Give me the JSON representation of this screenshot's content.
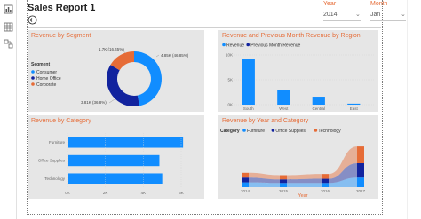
{
  "report": {
    "title": "Sales Report 1"
  },
  "slicers": {
    "year": {
      "label": "Year",
      "value": "2014"
    },
    "month": {
      "label": "Month",
      "value": "Jan"
    }
  },
  "colors": {
    "blue": "#118dff",
    "navy": "#12239e",
    "orange": "#e66c37",
    "accent_title": "#e66c37",
    "card_bg": "#e6e6e6"
  },
  "icons": [
    "bar-chart-icon",
    "table-icon",
    "model-icon",
    "back-arrow-icon",
    "chevron-down-icon"
  ],
  "charts": {
    "segment": {
      "title": "Revenue by Segment",
      "legend_title": "Segment",
      "chart_data": {
        "type": "pie",
        "donut": true,
        "categories": [
          "Consumer",
          "Home Office",
          "Corporate"
        ],
        "values": [
          4.85,
          3.81,
          1.7
        ],
        "data_labels": [
          "4.85K (46.85%)",
          "3.81K (36.8%)",
          "1.7K (16.45%)"
        ],
        "legend": "left"
      }
    },
    "region": {
      "title": "Revenue and Previous Month Revenue by Region",
      "legend": [
        "Revenue",
        "Previous Month Revenue"
      ],
      "chart_data": {
        "type": "bar",
        "categories": [
          "South",
          "West",
          "Central",
          "East"
        ],
        "series": [
          {
            "name": "Revenue",
            "values": [
              9200,
              3000,
              1600,
              200
            ]
          },
          {
            "name": "Previous Month Revenue",
            "values": [
              0,
              0,
              0,
              0
            ]
          }
        ],
        "y_ticks": [
          "0K",
          "5K",
          "10K"
        ],
        "ylim": [
          0,
          10000
        ]
      }
    },
    "category": {
      "title": "Revenue by Category",
      "chart_data": {
        "type": "bar",
        "orientation": "horizontal",
        "categories": [
          "Furniture",
          "Office Supplies",
          "Technology"
        ],
        "values": [
          6100,
          4850,
          5000
        ],
        "x_ticks": [
          "0K",
          "2K",
          "4K",
          "6K"
        ],
        "xlim": [
          0,
          6000
        ]
      }
    },
    "yearcat": {
      "title": "Revenue by Year and Category",
      "legend_title": "Category",
      "legend": [
        "Furniture",
        "Office Supplies",
        "Technology"
      ],
      "chart_data": {
        "type": "area",
        "stacked": "ribbon",
        "x": [
          "2014",
          "2015",
          "2016",
          "2017"
        ],
        "xlabel": "Year",
        "series": [
          {
            "name": "Furniture",
            "values": [
              4,
              3.5,
              3.5,
              8
            ]
          },
          {
            "name": "Office Supplies",
            "values": [
              4,
              3,
              3.5,
              12
            ]
          },
          {
            "name": "Technology",
            "values": [
              4,
              3.5,
              4,
              14
            ]
          }
        ]
      }
    }
  }
}
